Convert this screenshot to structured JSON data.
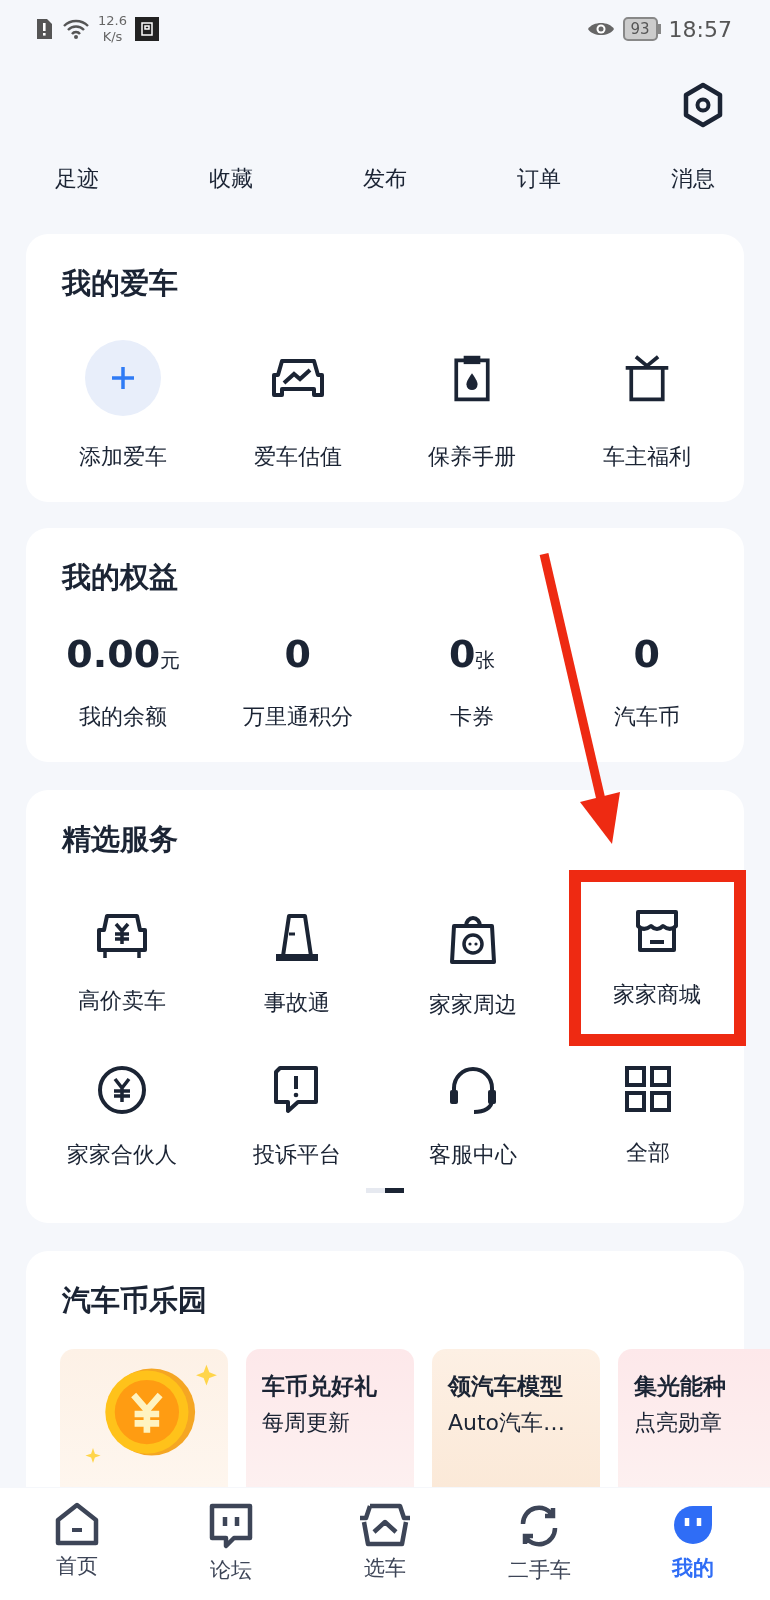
{
  "status_bar": {
    "speed_value": "12.6",
    "speed_unit": "K/s",
    "battery": "93",
    "time": "18:57"
  },
  "quick_links": [
    {
      "label": "足迹"
    },
    {
      "label": "收藏"
    },
    {
      "label": "发布"
    },
    {
      "label": "订单"
    },
    {
      "label": "消息"
    }
  ],
  "my_cars": {
    "title": "我的爱车",
    "items": [
      {
        "label": "添加爱车",
        "kind": "add"
      },
      {
        "label": "爱车估值",
        "kind": "value"
      },
      {
        "label": "保养手册",
        "kind": "manual"
      },
      {
        "label": "车主福利",
        "kind": "gift"
      }
    ]
  },
  "benefits": {
    "title": "我的权益",
    "items": [
      {
        "value": "0.00",
        "unit": "元",
        "label": "我的余额"
      },
      {
        "value": "0",
        "label": "万里通积分"
      },
      {
        "value": "0",
        "unit": "张",
        "label": "卡券"
      },
      {
        "value": "0",
        "label": "汽车币"
      }
    ]
  },
  "services": {
    "title": "精选服务",
    "items": [
      {
        "label": "高价卖车",
        "kind": "sell",
        "highlighted": false
      },
      {
        "label": "事故通",
        "kind": "cone",
        "highlighted": false
      },
      {
        "label": "家家周边",
        "kind": "bag",
        "highlighted": false
      },
      {
        "label": "家家商城",
        "kind": "shop",
        "highlighted": true
      },
      {
        "label": "家家合伙人",
        "kind": "coin",
        "highlighted": false
      },
      {
        "label": "投诉平台",
        "kind": "complain",
        "highlighted": false
      },
      {
        "label": "客服中心",
        "kind": "headset",
        "highlighted": false
      },
      {
        "label": "全部",
        "kind": "grid",
        "highlighted": false
      }
    ],
    "pages": [
      {
        "selected": false
      },
      {
        "selected": true
      }
    ]
  },
  "coin_park": {
    "title": "汽车币乐园",
    "cards": [
      {
        "kind": "coin"
      },
      {
        "kind": "text",
        "title": "车币兑好礼",
        "subtitle": "每周更新"
      },
      {
        "kind": "text",
        "title": "领汽车模型",
        "subtitle": "Auto汽车…"
      },
      {
        "kind": "text",
        "title": "集光能种",
        "subtitle": "点亮勋章"
      }
    ]
  },
  "tab_bar": [
    {
      "label": "首页",
      "kind": "home",
      "selected": false
    },
    {
      "label": "论坛",
      "kind": "forum",
      "selected": false
    },
    {
      "label": "选车",
      "kind": "car",
      "selected": false
    },
    {
      "label": "二手车",
      "kind": "cycle",
      "selected": false
    },
    {
      "label": "我的",
      "kind": "me",
      "selected": true
    }
  ]
}
